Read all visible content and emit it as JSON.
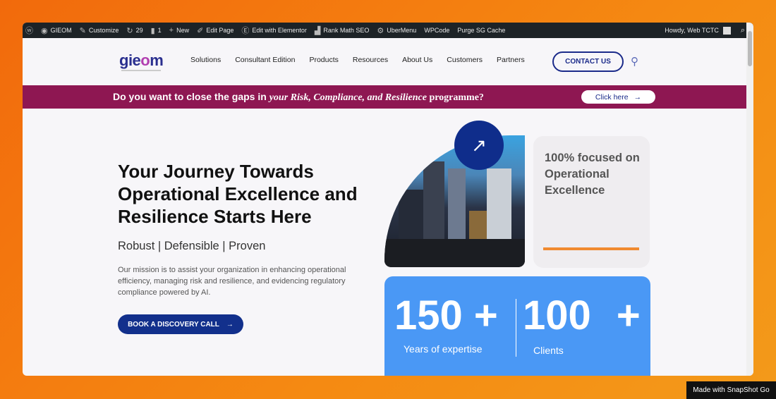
{
  "adminbar": {
    "items": [
      {
        "icon": "wordpress-icon",
        "label": ""
      },
      {
        "icon": "dashboard-icon",
        "label": "GIEOM"
      },
      {
        "icon": "brush-icon",
        "label": "Customize"
      },
      {
        "icon": "refresh-icon",
        "label": "29"
      },
      {
        "icon": "comment-icon",
        "label": "1"
      },
      {
        "icon": "plus-icon",
        "label": "New"
      },
      {
        "icon": "pencil-icon",
        "label": "Edit Page"
      },
      {
        "icon": "elementor-icon",
        "label": "Edit with Elementor"
      },
      {
        "icon": "rankmath-icon",
        "label": "Rank Math SEO"
      },
      {
        "icon": "gear-icon",
        "label": "UberMenu"
      },
      {
        "icon": "",
        "label": "WPCode"
      },
      {
        "icon": "",
        "label": "Purge SG Cache"
      }
    ],
    "howdy": "Howdy, Web TCTC"
  },
  "header": {
    "logo": "gieom",
    "nav": [
      "Solutions",
      "Consultant Edition",
      "Products",
      "Resources",
      "About Us",
      "Customers",
      "Partners"
    ],
    "contact": "CONTACT US"
  },
  "banner": {
    "text_pre": "Do you want to close the gaps in ",
    "text_em": "your Risk, Compliance, and Resilience",
    "text_post": " programme?",
    "button": "Click here"
  },
  "hero": {
    "title": "Your Journey Towards Operational Excellence and Resilience Starts Here",
    "tagline": "Robust | Defensible | Proven",
    "mission": "Our mission is to assist your organization in enhancing operational efficiency, managing risk and resilience, and evidencing regulatory compliance powered by AI.",
    "cta": "BOOK A DISCOVERY CALL"
  },
  "focus_card": "100% focused on Operational Excellence",
  "stats": [
    {
      "value": "150 +",
      "label": "Years of expertise"
    },
    {
      "value": "100 +",
      "label": "Clients"
    }
  ],
  "watermark": "Made with SnapShot Go",
  "colors": {
    "brand_blue": "#12308c",
    "banner": "#8e1752",
    "stats": "#4a98f5",
    "accent": "#f08a30"
  }
}
